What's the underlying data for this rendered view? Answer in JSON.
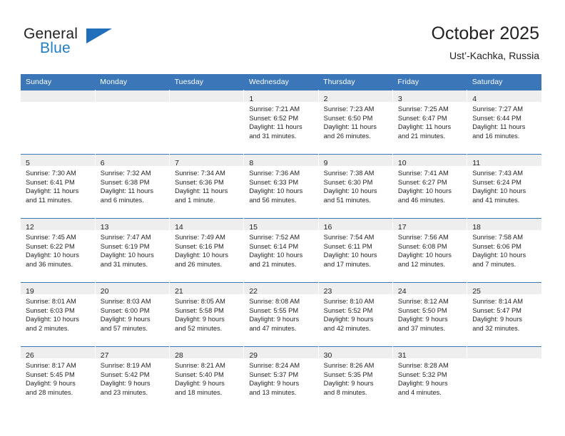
{
  "brand": {
    "name_top": "General",
    "name_bottom": "Blue",
    "triangle_color": "#1f6fbb",
    "blue_color": "#1f7ec4"
  },
  "header": {
    "title": "October 2025",
    "subtitle": "Ust’-Kachka, Russia"
  },
  "theme": {
    "header_row_bg": "#3a76b8",
    "header_row_text": "#ffffff",
    "daynum_band_bg": "#eeeeee",
    "row_divider": "#3a76b8",
    "text": "#231f20"
  },
  "calendar": {
    "weekday_headers": [
      "Sunday",
      "Monday",
      "Tuesday",
      "Wednesday",
      "Thursday",
      "Friday",
      "Saturday"
    ],
    "weeks": [
      [
        {
          "day": "",
          "lines": []
        },
        {
          "day": "",
          "lines": []
        },
        {
          "day": "",
          "lines": []
        },
        {
          "day": "1",
          "lines": [
            "Sunrise: 7:21 AM",
            "Sunset: 6:52 PM",
            "Daylight: 11 hours",
            "and 31 minutes."
          ]
        },
        {
          "day": "2",
          "lines": [
            "Sunrise: 7:23 AM",
            "Sunset: 6:50 PM",
            "Daylight: 11 hours",
            "and 26 minutes."
          ]
        },
        {
          "day": "3",
          "lines": [
            "Sunrise: 7:25 AM",
            "Sunset: 6:47 PM",
            "Daylight: 11 hours",
            "and 21 minutes."
          ]
        },
        {
          "day": "4",
          "lines": [
            "Sunrise: 7:27 AM",
            "Sunset: 6:44 PM",
            "Daylight: 11 hours",
            "and 16 minutes."
          ]
        }
      ],
      [
        {
          "day": "5",
          "lines": [
            "Sunrise: 7:30 AM",
            "Sunset: 6:41 PM",
            "Daylight: 11 hours",
            "and 11 minutes."
          ]
        },
        {
          "day": "6",
          "lines": [
            "Sunrise: 7:32 AM",
            "Sunset: 6:38 PM",
            "Daylight: 11 hours",
            "and 6 minutes."
          ]
        },
        {
          "day": "7",
          "lines": [
            "Sunrise: 7:34 AM",
            "Sunset: 6:36 PM",
            "Daylight: 11 hours",
            "and 1 minute."
          ]
        },
        {
          "day": "8",
          "lines": [
            "Sunrise: 7:36 AM",
            "Sunset: 6:33 PM",
            "Daylight: 10 hours",
            "and 56 minutes."
          ]
        },
        {
          "day": "9",
          "lines": [
            "Sunrise: 7:38 AM",
            "Sunset: 6:30 PM",
            "Daylight: 10 hours",
            "and 51 minutes."
          ]
        },
        {
          "day": "10",
          "lines": [
            "Sunrise: 7:41 AM",
            "Sunset: 6:27 PM",
            "Daylight: 10 hours",
            "and 46 minutes."
          ]
        },
        {
          "day": "11",
          "lines": [
            "Sunrise: 7:43 AM",
            "Sunset: 6:24 PM",
            "Daylight: 10 hours",
            "and 41 minutes."
          ]
        }
      ],
      [
        {
          "day": "12",
          "lines": [
            "Sunrise: 7:45 AM",
            "Sunset: 6:22 PM",
            "Daylight: 10 hours",
            "and 36 minutes."
          ]
        },
        {
          "day": "13",
          "lines": [
            "Sunrise: 7:47 AM",
            "Sunset: 6:19 PM",
            "Daylight: 10 hours",
            "and 31 minutes."
          ]
        },
        {
          "day": "14",
          "lines": [
            "Sunrise: 7:49 AM",
            "Sunset: 6:16 PM",
            "Daylight: 10 hours",
            "and 26 minutes."
          ]
        },
        {
          "day": "15",
          "lines": [
            "Sunrise: 7:52 AM",
            "Sunset: 6:14 PM",
            "Daylight: 10 hours",
            "and 21 minutes."
          ]
        },
        {
          "day": "16",
          "lines": [
            "Sunrise: 7:54 AM",
            "Sunset: 6:11 PM",
            "Daylight: 10 hours",
            "and 17 minutes."
          ]
        },
        {
          "day": "17",
          "lines": [
            "Sunrise: 7:56 AM",
            "Sunset: 6:08 PM",
            "Daylight: 10 hours",
            "and 12 minutes."
          ]
        },
        {
          "day": "18",
          "lines": [
            "Sunrise: 7:58 AM",
            "Sunset: 6:06 PM",
            "Daylight: 10 hours",
            "and 7 minutes."
          ]
        }
      ],
      [
        {
          "day": "19",
          "lines": [
            "Sunrise: 8:01 AM",
            "Sunset: 6:03 PM",
            "Daylight: 10 hours",
            "and 2 minutes."
          ]
        },
        {
          "day": "20",
          "lines": [
            "Sunrise: 8:03 AM",
            "Sunset: 6:00 PM",
            "Daylight: 9 hours",
            "and 57 minutes."
          ]
        },
        {
          "day": "21",
          "lines": [
            "Sunrise: 8:05 AM",
            "Sunset: 5:58 PM",
            "Daylight: 9 hours",
            "and 52 minutes."
          ]
        },
        {
          "day": "22",
          "lines": [
            "Sunrise: 8:08 AM",
            "Sunset: 5:55 PM",
            "Daylight: 9 hours",
            "and 47 minutes."
          ]
        },
        {
          "day": "23",
          "lines": [
            "Sunrise: 8:10 AM",
            "Sunset: 5:52 PM",
            "Daylight: 9 hours",
            "and 42 minutes."
          ]
        },
        {
          "day": "24",
          "lines": [
            "Sunrise: 8:12 AM",
            "Sunset: 5:50 PM",
            "Daylight: 9 hours",
            "and 37 minutes."
          ]
        },
        {
          "day": "25",
          "lines": [
            "Sunrise: 8:14 AM",
            "Sunset: 5:47 PM",
            "Daylight: 9 hours",
            "and 32 minutes."
          ]
        }
      ],
      [
        {
          "day": "26",
          "lines": [
            "Sunrise: 8:17 AM",
            "Sunset: 5:45 PM",
            "Daylight: 9 hours",
            "and 28 minutes."
          ]
        },
        {
          "day": "27",
          "lines": [
            "Sunrise: 8:19 AM",
            "Sunset: 5:42 PM",
            "Daylight: 9 hours",
            "and 23 minutes."
          ]
        },
        {
          "day": "28",
          "lines": [
            "Sunrise: 8:21 AM",
            "Sunset: 5:40 PM",
            "Daylight: 9 hours",
            "and 18 minutes."
          ]
        },
        {
          "day": "29",
          "lines": [
            "Sunrise: 8:24 AM",
            "Sunset: 5:37 PM",
            "Daylight: 9 hours",
            "and 13 minutes."
          ]
        },
        {
          "day": "30",
          "lines": [
            "Sunrise: 8:26 AM",
            "Sunset: 5:35 PM",
            "Daylight: 9 hours",
            "and 8 minutes."
          ]
        },
        {
          "day": "31",
          "lines": [
            "Sunrise: 8:28 AM",
            "Sunset: 5:32 PM",
            "Daylight: 9 hours",
            "and 4 minutes."
          ]
        },
        {
          "day": "",
          "lines": []
        }
      ]
    ]
  }
}
